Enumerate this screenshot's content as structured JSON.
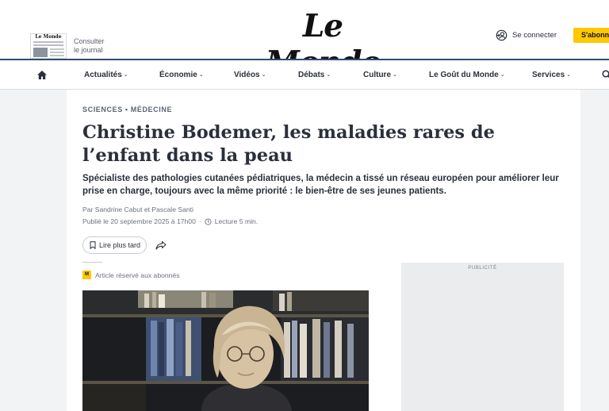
{
  "header": {
    "journal_thumb_masthead": "Le Monde",
    "consult_line1": "Consulter",
    "consult_line2": "le journal",
    "logo": "Le Monde",
    "login_label": "Se connecter",
    "subscribe_label": "S'abonne"
  },
  "nav": {
    "items": [
      "Actualités",
      "Économie",
      "Vidéos",
      "Débats",
      "Culture",
      "Le Goût du Monde",
      "Services"
    ]
  },
  "article": {
    "breadcrumb": "SCIENCES • MÉDECINE",
    "title": "Christine Bodemer, les maladies rares de l’enfant dans la peau",
    "lead": "Spécialiste des pathologies cutanées pédiatriques, la médecin a tissé un réseau européen pour améliorer leur prise en charge, toujours avec la même priorité : le bien-être de ses jeunes patients.",
    "byline": "Par Sandrine Cabut et Pascale Santi",
    "published": "Publié le 20 septembre 2025 à 17h00",
    "separator": "·",
    "reading_time": "Lecture 5 min.",
    "read_later_label": "Lire plus tard",
    "subscriber_badge": "M",
    "subscriber_note": "Article réservé aux abonnés",
    "ad_label": "PUBLICITÉ"
  },
  "colors": {
    "accent_yellow": "#ffc800",
    "header_rule": "#2f4d76",
    "text": "#2a303b"
  }
}
